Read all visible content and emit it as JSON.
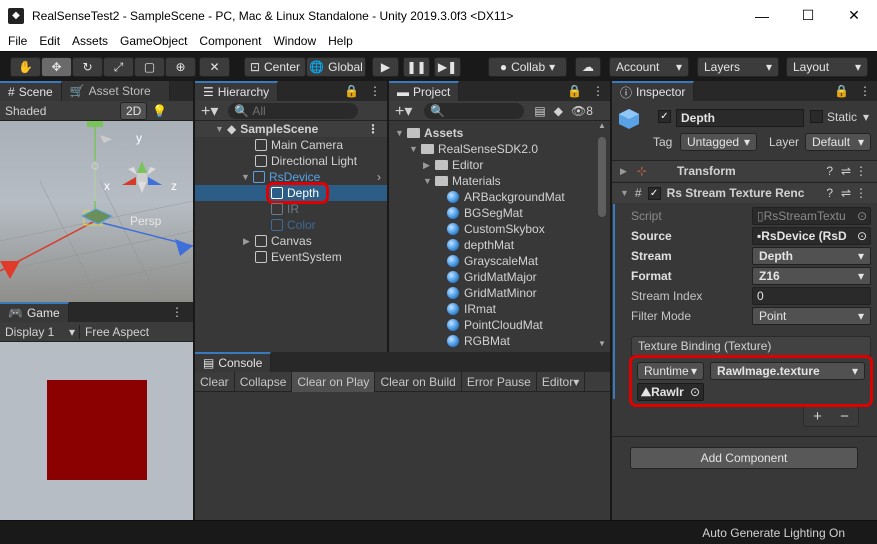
{
  "window": {
    "title": "RealSenseTest2 - SampleScene - PC, Mac & Linux Standalone - Unity 2019.3.0f3 <DX11>",
    "minimize": "—",
    "maximize": "☐",
    "close": "✕"
  },
  "menu": [
    "File",
    "Edit",
    "Assets",
    "GameObject",
    "Component",
    "Window",
    "Help"
  ],
  "toolbar": {
    "center_label": "Center",
    "global_label": "Global",
    "collab_label": "Collab",
    "account_label": "Account",
    "layers_label": "Layers",
    "layout_label": "Layout"
  },
  "scene": {
    "tab_scene": "Scene",
    "tab_asset_store": "Asset Store",
    "shading": "Shaded",
    "mode_2d": "2D",
    "persp": "Persp",
    "gizmo_x": "x",
    "gizmo_y": "y",
    "gizmo_z": "z"
  },
  "game": {
    "tab": "Game",
    "display": "Display 1",
    "aspect": "Free Aspect",
    "quad_color": "#8b0000"
  },
  "hierarchy": {
    "tab": "Hierarchy",
    "search_placeholder": "All",
    "scene_name": "SampleScene",
    "items": [
      "Main Camera",
      "Directional Light",
      "RsDevice",
      "Depth",
      "IR",
      "Color",
      "Canvas",
      "EventSystem"
    ]
  },
  "project": {
    "tab": "Project",
    "hidden_count": "8",
    "root": "Assets",
    "sdk": "RealSenseSDK2.0",
    "editor": "Editor",
    "materials": "Materials",
    "mats": [
      "ARBackgroundMat",
      "BGSegMat",
      "CustomSkybox",
      "depthMat",
      "GrayscaleMat",
      "GridMatMajor",
      "GridMatMinor",
      "IRmat",
      "PointCloudMat",
      "RGBMat"
    ]
  },
  "console": {
    "tab": "Console",
    "buttons": [
      "Clear",
      "Collapse",
      "Clear on Play",
      "Clear on Build",
      "Error Pause",
      "Editor"
    ]
  },
  "inspector": {
    "tab": "Inspector",
    "object_name": "Depth",
    "static_label": "Static",
    "tag_label": "Tag",
    "tag_value": "Untagged",
    "layer_label": "Layer",
    "layer_value": "Default",
    "transform_label": "Transform",
    "component_label": "Rs Stream Texture Renc",
    "rows": [
      {
        "label": "Script",
        "value": "RsStreamTextu"
      },
      {
        "label": "Source",
        "value": "RsDevice (RsD"
      },
      {
        "label": "Stream",
        "value": "Depth"
      },
      {
        "label": "Format",
        "value": "Z16"
      },
      {
        "label": "Stream Index",
        "value": "0"
      },
      {
        "label": "Filter Mode",
        "value": "Point"
      }
    ],
    "texture_binding_label": "Texture Binding (Texture)",
    "runtime_label": "Runtime",
    "function_label": "RawImage.texture",
    "object_ref": "RawIr",
    "plus": "+",
    "minus": "−",
    "add_component": "Add Component"
  },
  "status": {
    "text": "Auto Generate Lighting On"
  },
  "colors": {
    "accent_blue": "#3a79bb",
    "highlight_red": "#e00000",
    "selection": "#2c5d87"
  }
}
